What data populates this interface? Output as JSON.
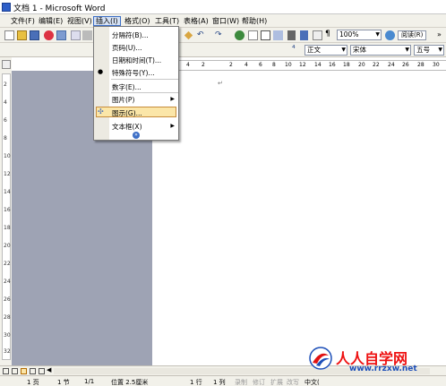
{
  "window": {
    "title": "文档 1 - Microsoft Word"
  },
  "menubar": {
    "items": [
      "文件(F)",
      "编辑(E)",
      "视图(V)",
      "插入(I)",
      "格式(O)",
      "工具(T)",
      "表格(A)",
      "窗口(W)",
      "帮助(H)"
    ],
    "active": "插入(I)"
  },
  "toolbar": {
    "zoom": "100%",
    "read_label": "阅读(R)"
  },
  "formatting": {
    "style": "正文",
    "font": "宋体",
    "size": "五号"
  },
  "ruler": {
    "h_numbers": [
      "4",
      "2",
      "2",
      "4",
      "6",
      "8",
      "10",
      "12",
      "14",
      "16",
      "18",
      "20",
      "22",
      "24",
      "26",
      "28",
      "30"
    ],
    "v_numbers": [
      "2",
      "4",
      "6",
      "8",
      "10",
      "12",
      "14",
      "16",
      "18",
      "20",
      "22",
      "24",
      "26",
      "28",
      "30",
      "32"
    ]
  },
  "insert_menu": {
    "items": [
      {
        "label": "分隔符(B)...",
        "submenu": false
      },
      {
        "label": "页码(U)...",
        "submenu": false
      },
      {
        "label": "日期和时间(T)...",
        "submenu": false
      },
      {
        "label": "特殊符号(Y)...",
        "submenu": false
      },
      {
        "label": "数字(E)...",
        "submenu": false
      },
      {
        "label": "图片(P)",
        "submenu": true
      },
      {
        "label": "图示(G)...",
        "submenu": false,
        "highlighted": true
      },
      {
        "label": "文本框(X)",
        "submenu": true
      }
    ],
    "expand_arrow": "»"
  },
  "statusbar": {
    "page": "1 页",
    "section": "1 节",
    "pages": "1/1",
    "position": "位置 2.5厘米",
    "line": "1 行",
    "column": "1 列",
    "rec": "录制",
    "trk": "修订",
    "ext": "扩展",
    "ovr": "改写",
    "lang": "中文("
  },
  "watermark": {
    "brand": "人人自学网",
    "url": "www.rrzxw.net"
  },
  "colors": {
    "menu_highlight": "#fbe6a8",
    "active_menu": "#d6e2f5",
    "gray_area": "#9ea3b4",
    "brand_red": "#e11111",
    "brand_blue": "#1d4fb8"
  }
}
